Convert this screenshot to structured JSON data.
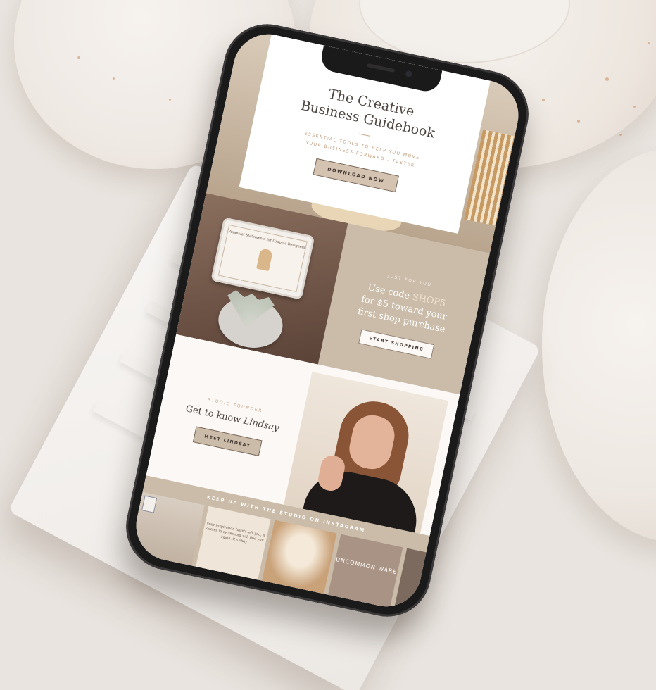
{
  "hero": {
    "title_line1": "The Creative",
    "title_line2": "Business Guidebook",
    "subtitle_line1": "ESSENTIAL TOOLS TO HELP YOU MOVE",
    "subtitle_line2": "YOUR BUSINESS FORWARD – FASTER",
    "button": "DOWNLOAD NOW"
  },
  "promo": {
    "tablet_title": "Financial Statements for Graphic Designers",
    "eyebrow": "JUST FOR YOU",
    "line1_prefix": "Use code ",
    "code": "SHOP5",
    "line2": "for $5 toward your",
    "line3": "first shop purchase",
    "button": "START SHOPPING"
  },
  "founder": {
    "eyebrow": "STUDIO FOUNDER",
    "head_prefix": "Get to know ",
    "head_name": "Lindsay",
    "button": "MEET LINDSAY"
  },
  "instagram": {
    "label": "KEEP UP WITH THE STUDIO ON INSTAGRAM",
    "tile2_text": "your inspiration hasn't left you, it comes in cycles and will find you again. it's okay",
    "tile4_text": "UNCOMMON WARE"
  },
  "colors": {
    "tan": "#cbbca9",
    "cream": "#fbf8f5",
    "accent": "#c1997a",
    "dark_text": "#4e4540"
  }
}
